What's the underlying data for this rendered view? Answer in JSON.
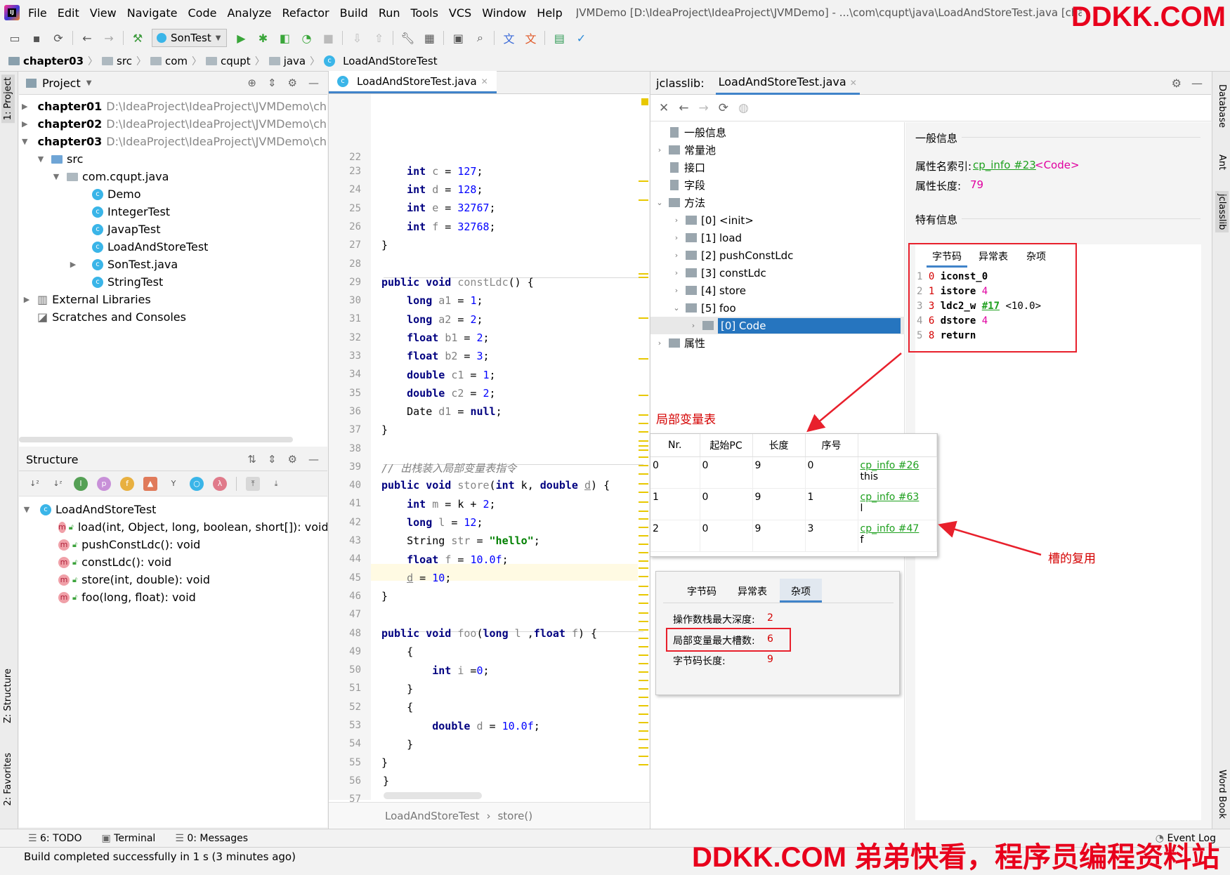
{
  "menubar": {
    "items": [
      "File",
      "Edit",
      "View",
      "Navigate",
      "Code",
      "Analyze",
      "Refactor",
      "Build",
      "Run",
      "Tools",
      "VCS",
      "Window",
      "Help"
    ],
    "title": "JVMDemo [D:\\IdeaProject\\IdeaProject\\JVMDemo] - ...\\com\\cqupt\\java\\LoadAndStoreTest.java [chapter03]"
  },
  "watermark_top": "DDKK.COM",
  "watermark_bottom": "DDKK.COM 弟弟快看，程序员编程资料站",
  "toolbar": {
    "run_config": "SonTest"
  },
  "breadcrumb": [
    "chapter03",
    "src",
    "com",
    "cqupt",
    "java",
    "LoadAndStoreTest"
  ],
  "left_strip": {
    "project": "1: Project",
    "structure": "Z: Structure",
    "favorites": "2: Favorites"
  },
  "right_strip": {
    "database": "Database",
    "ant": "Ant",
    "jclasslib": "jclasslib",
    "wordbook": "Word Book"
  },
  "project": {
    "title": "Project",
    "modules": [
      {
        "name": "chapter01",
        "path": "D:\\IdeaProject\\IdeaProject\\JVMDemo\\cha"
      },
      {
        "name": "chapter02",
        "path": "D:\\IdeaProject\\IdeaProject\\JVMDemo\\cha"
      },
      {
        "name": "chapter03",
        "path": "D:\\IdeaProject\\IdeaProject\\JVMDemo\\cha"
      }
    ],
    "src": "src",
    "package": "com.cqupt.java",
    "classes": [
      "Demo",
      "IntegerTest",
      "JavapTest",
      "LoadAndStoreTest",
      "SonTest.java",
      "StringTest"
    ],
    "external": "External Libraries",
    "scratches": "Scratches and Consoles"
  },
  "structure": {
    "title": "Structure",
    "root": "LoadAndStoreTest",
    "methods": [
      "load(int, Object, long, boolean, short[]): void",
      "pushConstLdc(): void",
      "constLdc(): void",
      "store(int, double): void",
      "foo(long, float): void"
    ]
  },
  "editor": {
    "tab": "LoadAndStoreTest.java",
    "line_numbers": [
      "22",
      "23",
      "24",
      "25",
      "26",
      "27",
      "28",
      "29",
      "30",
      "31",
      "32",
      "33",
      "34",
      "35",
      "36",
      "37",
      "38",
      "39",
      "40",
      "41",
      "42",
      "43",
      "44",
      "45",
      "46",
      "47",
      "48",
      "49",
      "50",
      "51",
      "52",
      "53",
      "54",
      "55",
      "56",
      "57"
    ],
    "crumb": [
      "LoadAndStoreTest",
      "store()"
    ]
  },
  "jclasslib": {
    "title": "jclasslib:",
    "tab": "LoadAndStoreTest.java",
    "tree": {
      "general": "一般信息",
      "constant_pool": "常量池",
      "interfaces": "接口",
      "fields": "字段",
      "methods": "方法",
      "method_items": [
        "[0] <init>",
        "[1] load",
        "[2] pushConstLdc",
        "[3] constLdc",
        "[4] store",
        "[5] foo"
      ],
      "code": "[0] Code",
      "attributes": "属性"
    },
    "detail": {
      "general_title": "一般信息",
      "name_index_label": "属性名索引:",
      "name_index_link": "cp_info #23",
      "name_index_value": "<Code>",
      "length_label": "属性长度:",
      "length_value": "79",
      "specific_title": "特有信息",
      "tabs": [
        "字节码",
        "异常表",
        "杂项"
      ],
      "bytecode": [
        {
          "line": "1",
          "offset": "0",
          "op": "iconst_0",
          "arg": ""
        },
        {
          "line": "2",
          "offset": "1",
          "op": "istore",
          "arg": "4"
        },
        {
          "line": "3",
          "offset": "3",
          "op": "ldc2_w",
          "arg": "#17",
          "extra": "<10.0>"
        },
        {
          "line": "4",
          "offset": "6",
          "op": "dstore",
          "arg": "4"
        },
        {
          "line": "5",
          "offset": "8",
          "op": "return",
          "arg": ""
        }
      ]
    }
  },
  "annotations": {
    "local_var_table": "局部变量表",
    "slot_reuse": "槽的复用"
  },
  "lvt": {
    "headers": [
      "Nr.",
      "起始PC",
      "长度",
      "序号",
      ""
    ],
    "rows": [
      {
        "nr": "0",
        "start": "0",
        "len": "9",
        "idx": "0",
        "link": "cp_info #26",
        "name": "this"
      },
      {
        "nr": "1",
        "start": "0",
        "len": "9",
        "idx": "1",
        "link": "cp_info #63",
        "name": "l"
      },
      {
        "nr": "2",
        "start": "0",
        "len": "9",
        "idx": "3",
        "link": "cp_info #47",
        "name": "f"
      }
    ]
  },
  "misc": {
    "tabs": [
      "字节码",
      "异常表",
      "杂项"
    ],
    "max_stack_label": "操作数栈最大深度:",
    "max_stack": "2",
    "max_locals_label": "局部变量最大槽数:",
    "max_locals": "6",
    "code_length_label": "字节码长度:",
    "code_length": "9"
  },
  "bottom_tabs": [
    "6: TODO",
    "Terminal",
    "0: Messages"
  ],
  "event_log": "Event Log",
  "status": "Build completed successfully in 1 s (3 minutes ago)",
  "colors": {
    "accent": "#4083c9",
    "selection": "#2675bf",
    "annotation": "#e8202c",
    "link": "#1ea01e"
  }
}
